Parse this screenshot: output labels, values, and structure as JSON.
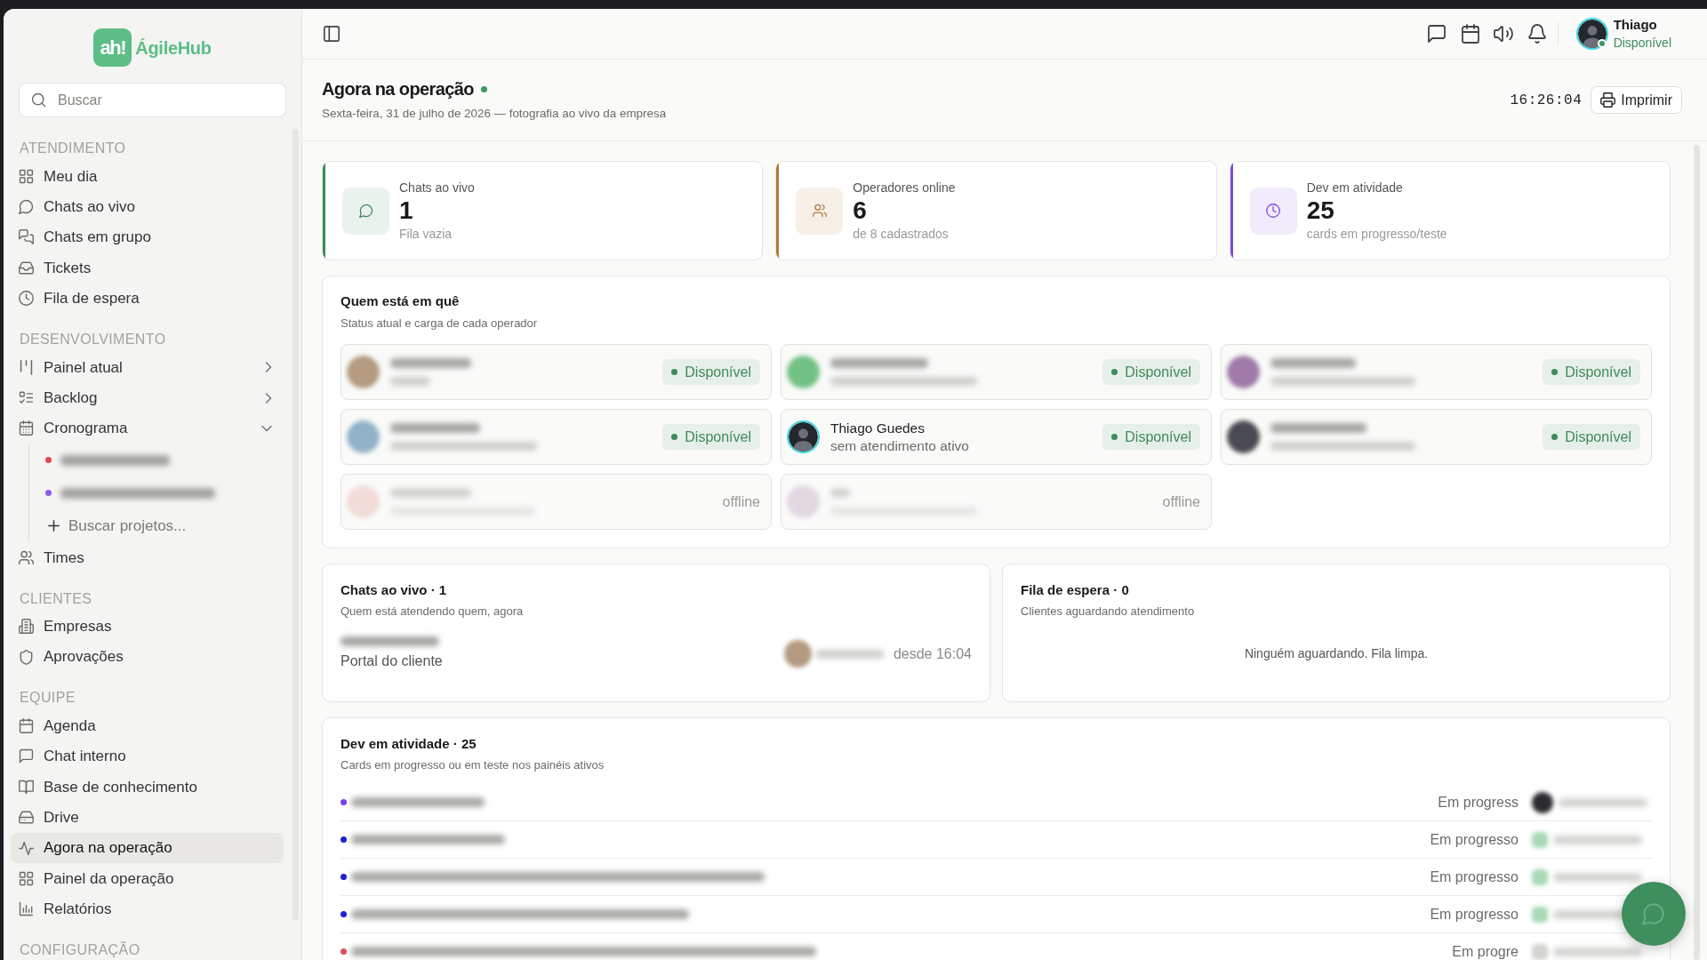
{
  "sidebar": {
    "logo": {
      "mark": "ah!",
      "name": "ÁgileHub"
    },
    "search": {
      "placeholder": "Buscar"
    },
    "sections": [
      {
        "title": "ATENDIMENTO",
        "items": [
          {
            "label": "Meu dia",
            "selected": false
          },
          {
            "label": "Chats ao vivo",
            "selected": false
          },
          {
            "label": "Chats em grupo",
            "selected": false
          },
          {
            "label": "Tickets",
            "selected": false
          },
          {
            "label": "Fila de espera",
            "selected": false
          }
        ]
      },
      {
        "title": "DESENVOLVIMENTO",
        "items": [
          {
            "label": "Painel atual",
            "selected": false,
            "expanded": false
          },
          {
            "label": "Backlog",
            "selected": false,
            "expanded": false
          },
          {
            "label": "Cronograma",
            "selected": false,
            "expanded": true,
            "children": [
              {
                "kind": "project",
                "redacted": true,
                "color": "#e5484d"
              },
              {
                "kind": "project",
                "redacted": true,
                "color": "#8b5cf6"
              },
              {
                "kind": "action",
                "label": "Buscar projetos..."
              }
            ]
          },
          {
            "label": "Times",
            "selected": false
          }
        ]
      },
      {
        "title": "CLIENTES",
        "items": [
          {
            "label": "Empresas",
            "selected": false
          },
          {
            "label": "Aprovações",
            "selected": false
          }
        ]
      },
      {
        "title": "EQUIPE",
        "items": [
          {
            "label": "Agenda",
            "selected": false
          },
          {
            "label": "Chat interno",
            "selected": false
          },
          {
            "label": "Base de conhecimento",
            "selected": false
          },
          {
            "label": "Drive",
            "selected": false
          },
          {
            "label": "Agora na operação",
            "selected": true
          },
          {
            "label": "Painel da operação",
            "selected": false
          },
          {
            "label": "Relatórios",
            "selected": false
          }
        ]
      },
      {
        "title": "CONFIGURAÇÃO"
      }
    ]
  },
  "topbar": {
    "user": {
      "name": "Thiago",
      "status": "Disponível",
      "online": true
    }
  },
  "header": {
    "title": "Agora na operação",
    "live": true,
    "subtitle": "Sexta-feira, 31 de julho de 2026 — fotografia ao vivo da empresa",
    "clock": "16:26:04",
    "print_button": "Imprimir"
  },
  "stats": [
    {
      "label": "Chats ao vivo",
      "value": "1",
      "note": "Fila vazia",
      "color": "#3d8b5a"
    },
    {
      "label": "Operadores online",
      "value": "6",
      "note": "de 8 cadastrados",
      "color": "#b07a3a"
    },
    {
      "label": "Dev em atividade",
      "value": "25",
      "note": "cards em progresso/teste",
      "color": "#7c4ddb"
    }
  ],
  "operators": {
    "title": "Quem está em quê",
    "subtitle": "Status atual e carga de cada operador",
    "items": [
      {
        "redacted": true,
        "current_user": false,
        "online": true,
        "status": "Disponível"
      },
      {
        "redacted": true,
        "current_user": false,
        "online": true,
        "status": "Disponível"
      },
      {
        "redacted": true,
        "current_user": false,
        "online": true,
        "status": "Disponível"
      },
      {
        "redacted": true,
        "current_user": false,
        "online": true,
        "status": "Disponível"
      },
      {
        "redacted": false,
        "name": "Thiago Guedes",
        "detail": "sem atendimento ativo",
        "current_user": true,
        "online": true,
        "status": "Disponível"
      },
      {
        "redacted": true,
        "current_user": false,
        "online": true,
        "status": "Disponível"
      },
      {
        "redacted": true,
        "current_user": false,
        "online": false,
        "status": "offline"
      },
      {
        "redacted": true,
        "current_user": false,
        "online": false,
        "status": "offline"
      }
    ]
  },
  "live_chats": {
    "title": "Chats ao vivo · 1",
    "subtitle": "Quem está atendendo quem, agora",
    "chats": [
      {
        "redacted": true,
        "channel": "Portal do cliente",
        "since": "desde 16:04"
      }
    ]
  },
  "queue": {
    "title": "Fila de espera · 0",
    "subtitle": "Clientes aguardando atendimento",
    "empty_message": "Ninguém aguardando. Fila limpa."
  },
  "dev_activity": {
    "title": "Dev em atividade · 25",
    "subtitle": "Cards em progresso ou em teste nos painéis ativos",
    "rows": [
      {
        "color": "#7b3fe4",
        "redacted": true,
        "status": "Em progress"
      },
      {
        "color": "#2020d0",
        "redacted": true,
        "status": "Em progresso"
      },
      {
        "color": "#2020d0",
        "redacted": true,
        "status": "Em progresso"
      },
      {
        "color": "#2020d0",
        "redacted": true,
        "status": "Em progresso"
      },
      {
        "color": "#e0505a",
        "redacted": true,
        "status": "Em progre"
      }
    ]
  }
}
